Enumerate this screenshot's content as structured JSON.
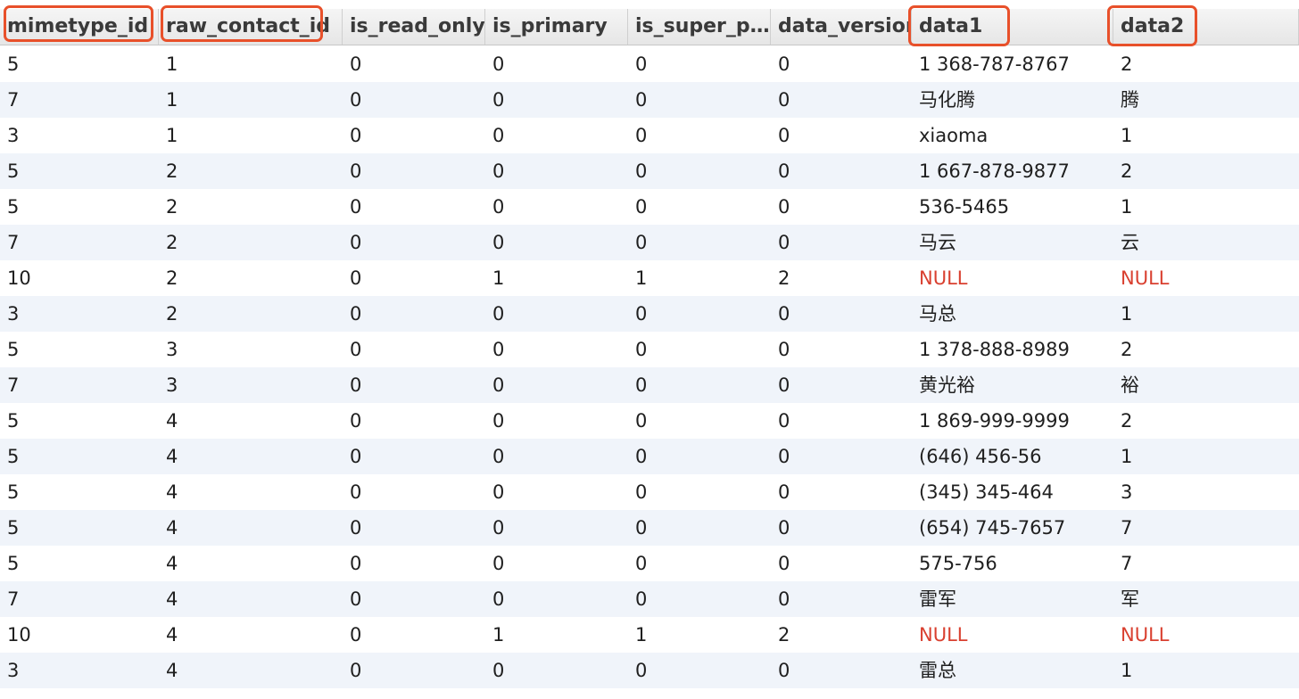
{
  "columns": [
    "mimetype_id",
    "raw_contact_id",
    "is_read_only",
    "is_primary",
    "is_super_p…",
    "data_version",
    "data1",
    "data2"
  ],
  "rows": [
    [
      "5",
      "1",
      "0",
      "0",
      "0",
      "0",
      "1 368-787-8767",
      "2"
    ],
    [
      "7",
      "1",
      "0",
      "0",
      "0",
      "0",
      "马化腾",
      "腾"
    ],
    [
      "3",
      "1",
      "0",
      "0",
      "0",
      "0",
      "xiaoma",
      "1"
    ],
    [
      "5",
      "2",
      "0",
      "0",
      "0",
      "0",
      "1 667-878-9877",
      "2"
    ],
    [
      "5",
      "2",
      "0",
      "0",
      "0",
      "0",
      "536-5465",
      "1"
    ],
    [
      "7",
      "2",
      "0",
      "0",
      "0",
      "0",
      "马云",
      "云"
    ],
    [
      "10",
      "2",
      "0",
      "1",
      "1",
      "2",
      "NULL",
      "NULL"
    ],
    [
      "3",
      "2",
      "0",
      "0",
      "0",
      "0",
      "马总",
      "1"
    ],
    [
      "5",
      "3",
      "0",
      "0",
      "0",
      "0",
      "1 378-888-8989",
      "2"
    ],
    [
      "7",
      "3",
      "0",
      "0",
      "0",
      "0",
      "黄光裕",
      "裕"
    ],
    [
      "5",
      "4",
      "0",
      "0",
      "0",
      "0",
      "1 869-999-9999",
      "2"
    ],
    [
      "5",
      "4",
      "0",
      "0",
      "0",
      "0",
      "(646) 456-56",
      "1"
    ],
    [
      "5",
      "4",
      "0",
      "0",
      "0",
      "0",
      "(345) 345-464",
      "3"
    ],
    [
      "5",
      "4",
      "0",
      "0",
      "0",
      "0",
      "(654) 745-7657",
      "7"
    ],
    [
      "5",
      "4",
      "0",
      "0",
      "0",
      "0",
      "575-756",
      "7"
    ],
    [
      "7",
      "4",
      "0",
      "0",
      "0",
      "0",
      "雷军",
      "军"
    ],
    [
      "10",
      "4",
      "0",
      "1",
      "1",
      "2",
      "NULL",
      "NULL"
    ],
    [
      "3",
      "4",
      "0",
      "0",
      "0",
      "0",
      "雷总",
      "1"
    ]
  ],
  "highlighted_columns": [
    "mimetype_id",
    "raw_contact_id",
    "data1",
    "data2"
  ],
  "colors": {
    "null_text": "#d94030",
    "highlight_border": "#e8502a",
    "stripe": "#f0f4fa"
  }
}
